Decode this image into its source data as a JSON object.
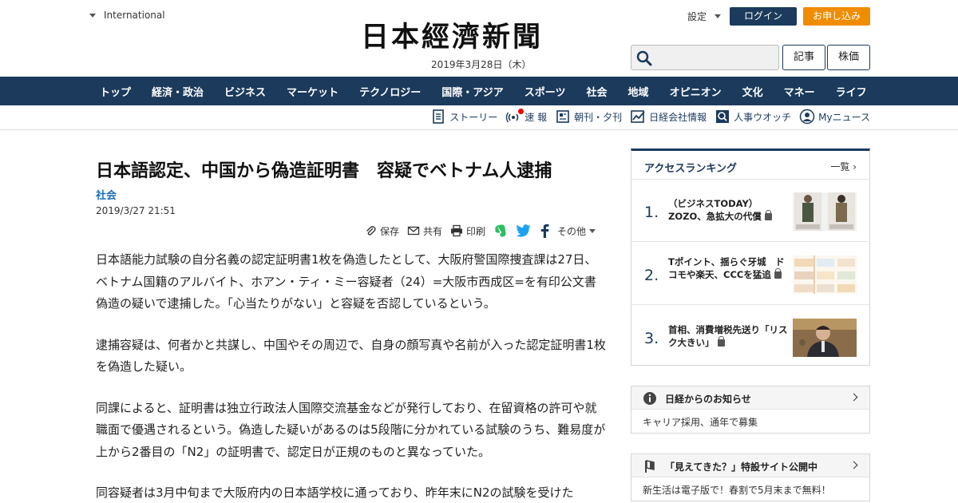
{
  "header": {
    "international": "International",
    "logo": "日本經濟新聞",
    "date": "2019年3月28日（木）",
    "settings": "設定",
    "login": "ログイン",
    "apply": "お申し込み",
    "search_placeholder": "",
    "btn_articles": "記事",
    "btn_stock": "株価"
  },
  "nav": [
    "トップ",
    "経済・政治",
    "ビジネス",
    "マーケット",
    "テクノロジー",
    "国際・アジア",
    "スポーツ",
    "社会",
    "地域",
    "オピニオン",
    "文化",
    "マネー",
    "ライフ"
  ],
  "subnav": [
    {
      "label": "ストーリー",
      "icon": "document-icon"
    },
    {
      "label": "速 報",
      "icon": "broadcast-icon"
    },
    {
      "label": "朝刊・夕刊",
      "icon": "newspaper-icon"
    },
    {
      "label": "日経会社情報",
      "icon": "chart-icon"
    },
    {
      "label": "人事ウオッチ",
      "icon": "search-person-icon"
    },
    {
      "label": "Myニュース",
      "icon": "user-icon"
    }
  ],
  "article": {
    "headline": "日本語認定、中国から偽造証明書　容疑でベトナム人逮捕",
    "category": "社会",
    "date": "2019/3/27 21:51",
    "tools": {
      "save": "保存",
      "share": "共有",
      "print": "印刷",
      "other": "その他"
    },
    "paragraphs": [
      "日本語能力試験の自分名義の認定証明書1枚を偽造したとして、大阪府警国際捜査課は27日、ベトナム国籍のアルバイト、ホアン・ティ・ミー容疑者（24）=大阪市西成区=を有印公文書偽造の疑いで逮捕した。「心当たりがない」と容疑を否認しているという。",
      "逮捕容疑は、何者かと共謀し、中国やその周辺で、自身の顔写真や名前が入った認定証明書1枚を偽造した疑い。",
      "同課によると、証明書は独立行政法人国際交流基金などが発行しており、在留資格の許可や就職面で優遇されるという。偽造した疑いがあるのは5段階に分かれている試験のうち、難易度が上から2番目の「N2」の証明書で、認定日が正規のものと異なっていた。",
      "同容疑者は3月中旬まで大阪府内の日本語学校に通っており、昨年末にN2の試験を受けた"
    ]
  },
  "ranking": {
    "title": "アクセスランキング",
    "more": "一覧",
    "items": [
      {
        "num": "1.",
        "text": "（ビジネスTODAY）ZOZO、急拡大の代償"
      },
      {
        "num": "2.",
        "text": "Tポイント、揺らぐ牙城　ドコモや楽天、CCCを猛追"
      },
      {
        "num": "3.",
        "text": "首相、消費増税先送り「リスク大きい」"
      }
    ]
  },
  "notices": [
    {
      "title": "日経からのお知らせ",
      "body": "キャリア採用、通年で募集",
      "icon": "info-icon"
    },
    {
      "title": "「見えてきた？」特設サイト公開中",
      "body": "新生活は電子版で！春割で5月末まで無料！",
      "icon": "flag-icon"
    }
  ],
  "colors": {
    "navy": "#1b3a5c",
    "orange": "#f08c00",
    "link_blue": "#1b6fb5"
  }
}
